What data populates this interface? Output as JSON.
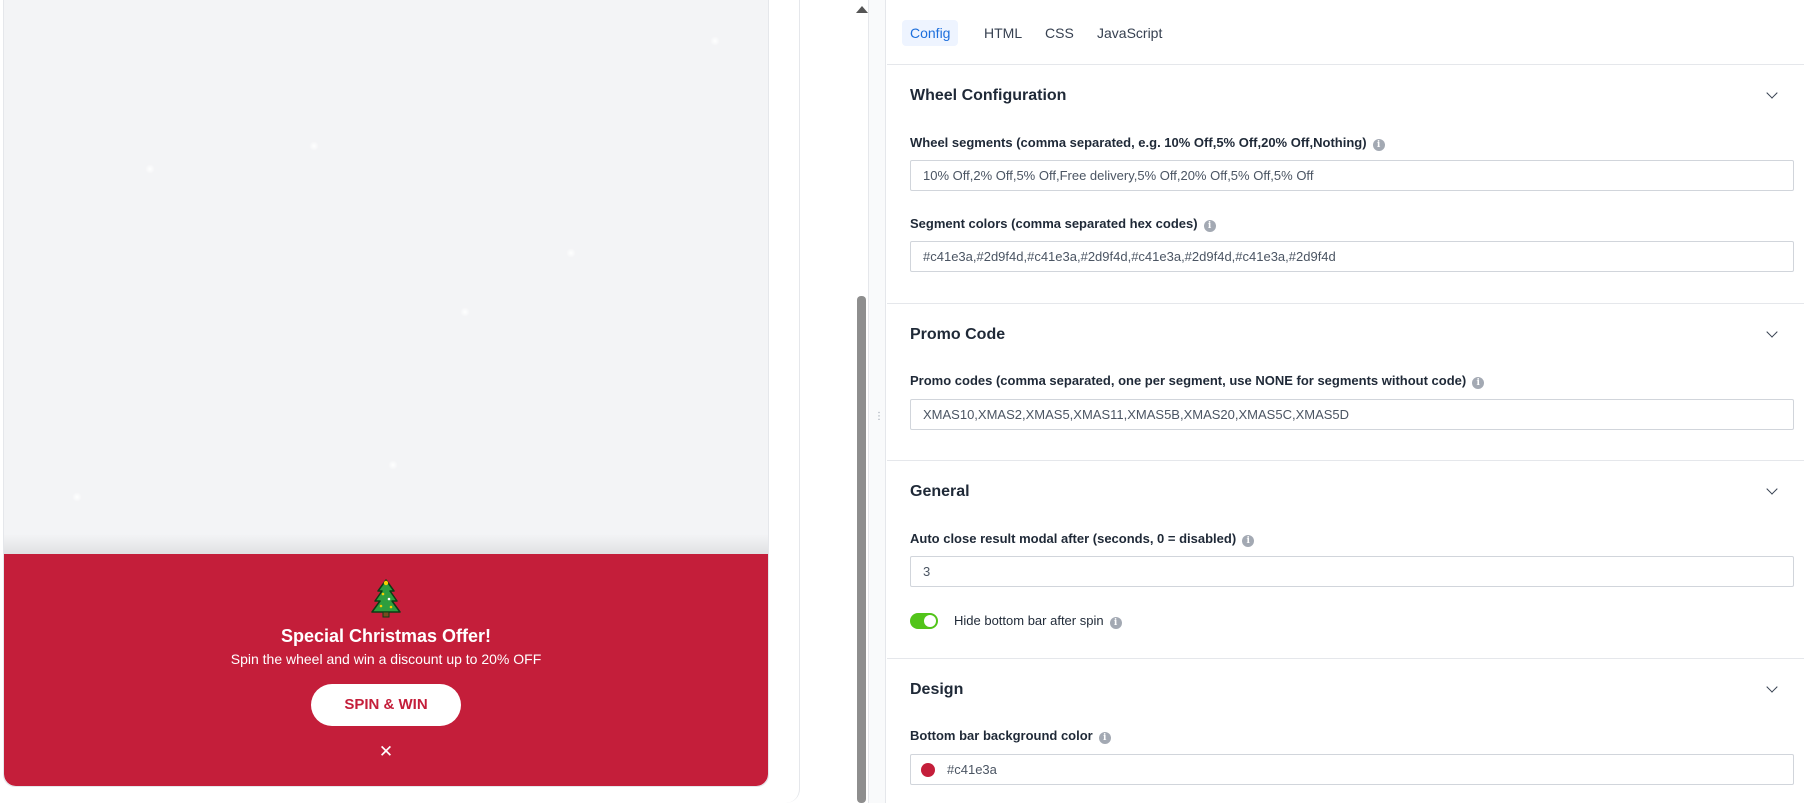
{
  "preview": {
    "offer_title": "Special Christmas Offer!",
    "offer_subtitle": "Spin the wheel and win a discount up to 20% OFF",
    "spin_button": "SPIN & WIN",
    "close": "✕",
    "tree_icon": "christmas-tree-icon",
    "bar_color": "#c41e3a"
  },
  "tabs": [
    {
      "label": "Config",
      "active": true
    },
    {
      "label": "HTML",
      "active": false
    },
    {
      "label": "CSS",
      "active": false
    },
    {
      "label": "JavaScript",
      "active": false
    }
  ],
  "sections": {
    "wheel": {
      "title": "Wheel Configuration",
      "segments_label": "Wheel segments (comma separated, e.g. 10% Off,5% Off,20% Off,Nothing)",
      "segments_value": "10% Off,2% Off,5% Off,Free delivery,5% Off,20% Off,5% Off,5% Off",
      "colors_label": "Segment colors (comma separated hex codes)",
      "colors_value": "#c41e3a,#2d9f4d,#c41e3a,#2d9f4d,#c41e3a,#2d9f4d,#c41e3a,#2d9f4d"
    },
    "promo": {
      "title": "Promo Code",
      "codes_label": "Promo codes (comma separated, one per segment, use NONE for segments without code)",
      "codes_value": "XMAS10,XMAS2,XMAS5,XMAS11,XMAS5B,XMAS20,XMAS5C,XMAS5D"
    },
    "general": {
      "title": "General",
      "autoclose_label": "Auto close result modal after (seconds, 0 = disabled)",
      "autoclose_value": "3",
      "hide_bar_label": "Hide bottom bar after spin",
      "hide_bar_on": true
    },
    "design": {
      "title": "Design",
      "bar_bg_label": "Bottom bar background color",
      "bar_bg_value": "#c41e3a"
    }
  },
  "info_glyph": "i"
}
